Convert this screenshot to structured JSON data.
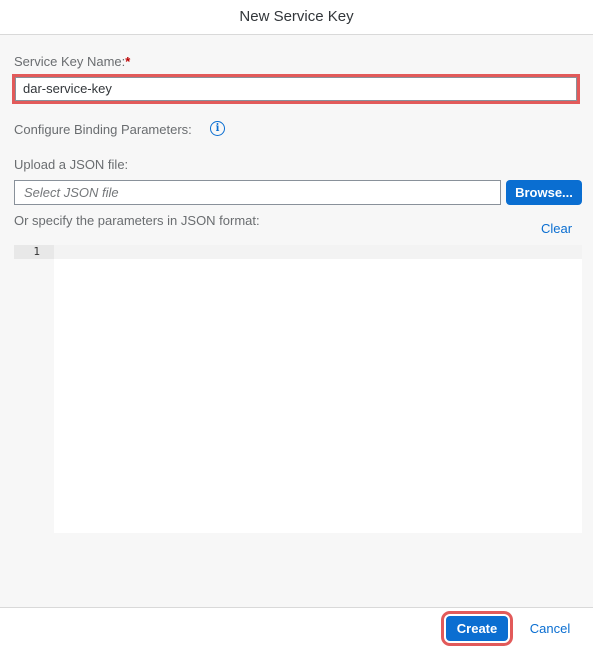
{
  "dialog": {
    "title": "New Service Key"
  },
  "service_key": {
    "label": "Service Key Name:",
    "required_marker": "*",
    "value": "dar-service-key"
  },
  "binding": {
    "label": "Configure Binding Parameters:",
    "info_icon": "info-icon"
  },
  "upload": {
    "label": "Upload a JSON file:",
    "placeholder": "Select JSON file",
    "browse_label": "Browse..."
  },
  "json_params": {
    "label": "Or specify the parameters in JSON format:",
    "clear_label": "Clear",
    "line_number": "1"
  },
  "footer": {
    "create_label": "Create",
    "cancel_label": "Cancel"
  },
  "colors": {
    "accent": "#0a6ed1",
    "highlight": "#e25a5a",
    "required": "#bb0000"
  }
}
